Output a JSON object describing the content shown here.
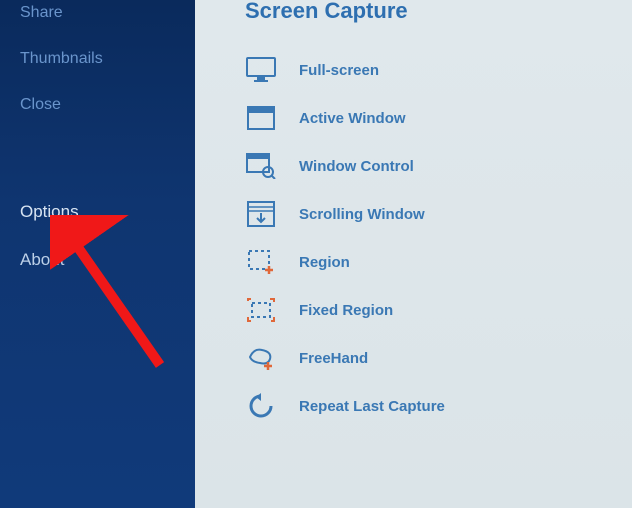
{
  "sidebar": {
    "items": [
      {
        "label": "Share"
      },
      {
        "label": "Thumbnails"
      },
      {
        "label": "Close"
      },
      {
        "label": "Options"
      },
      {
        "label": "About"
      }
    ]
  },
  "main": {
    "title": "Screen Capture",
    "items": [
      {
        "label": "Full-screen",
        "icon": "monitor-icon"
      },
      {
        "label": "Active Window",
        "icon": "window-icon"
      },
      {
        "label": "Window Control",
        "icon": "window-search-icon"
      },
      {
        "label": "Scrolling Window",
        "icon": "scroll-icon"
      },
      {
        "label": "Region",
        "icon": "region-icon"
      },
      {
        "label": "Fixed Region",
        "icon": "fixed-region-icon"
      },
      {
        "label": "FreeHand",
        "icon": "freehand-icon"
      },
      {
        "label": "Repeat Last Capture",
        "icon": "repeat-icon"
      }
    ]
  },
  "colors": {
    "accent": "#3a78b4",
    "orange": "#e0683a",
    "arrow": "#f01818"
  }
}
